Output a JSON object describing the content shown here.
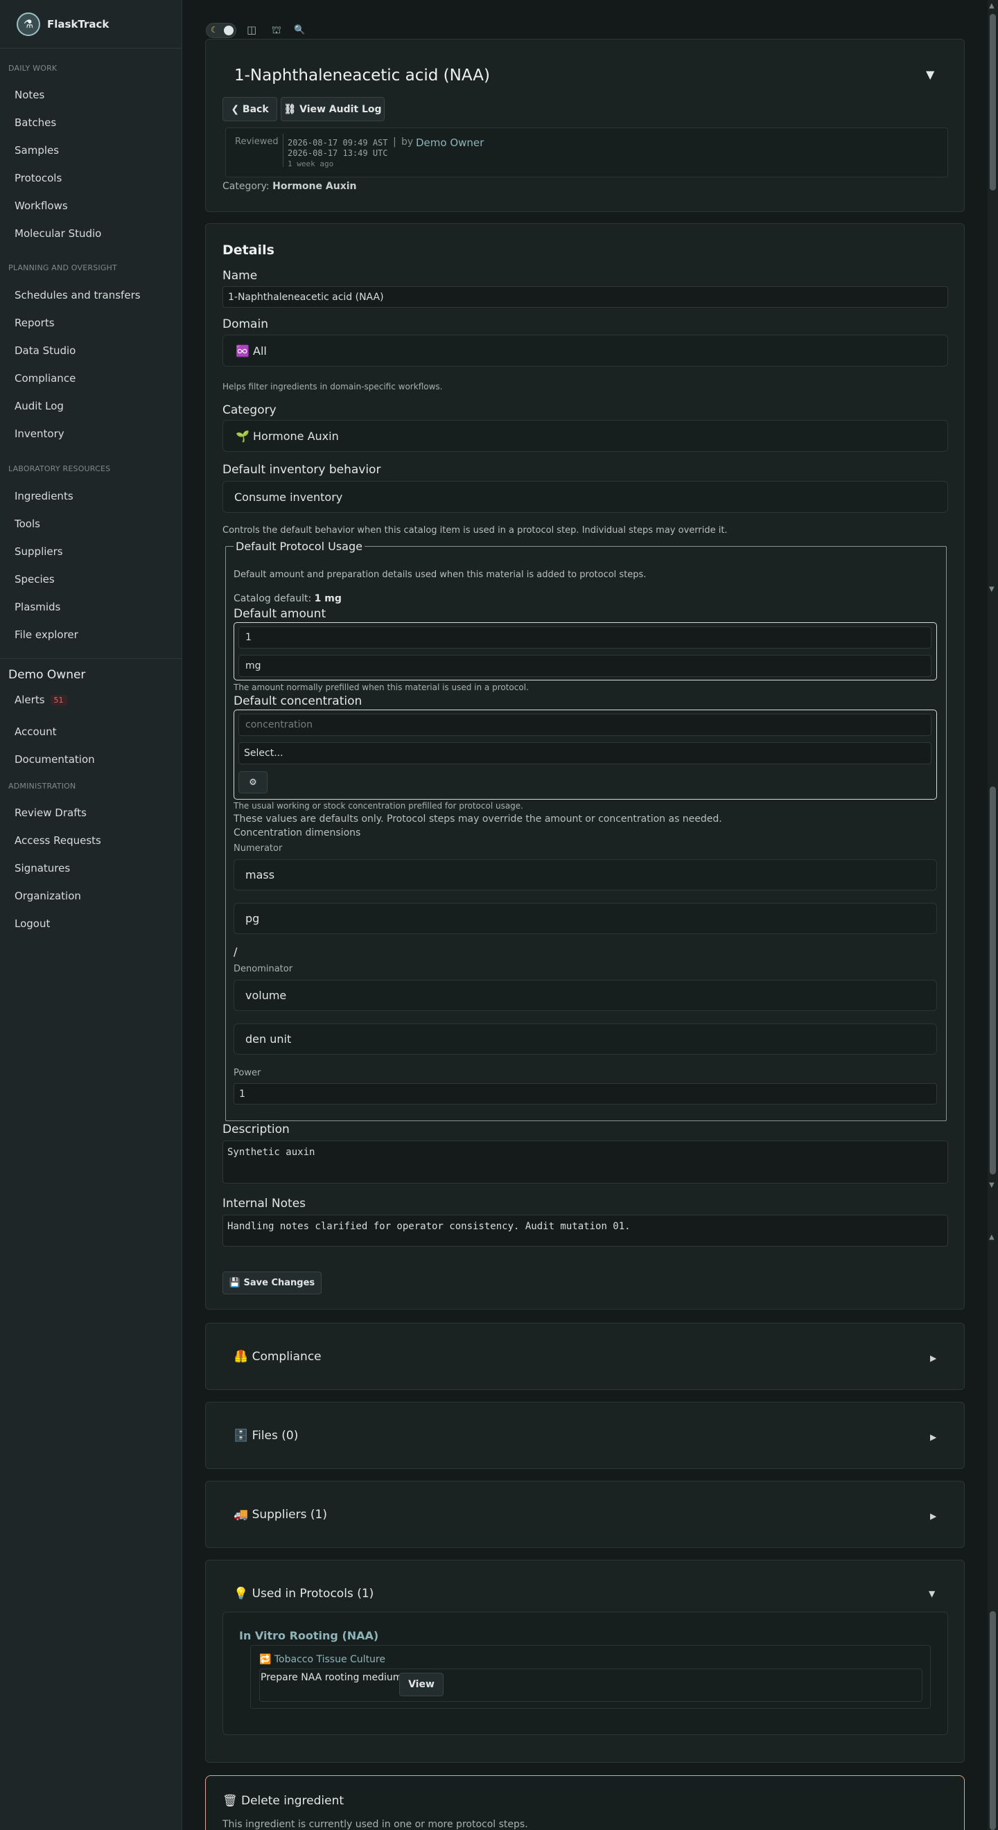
{
  "sidebar": {
    "brand": "FlaskTrack",
    "sections": [
      {
        "title": "DAILY WORK",
        "items": [
          "Notes",
          "Batches",
          "Samples",
          "Protocols",
          "Workflows",
          "Molecular Studio"
        ]
      },
      {
        "title": "PLANNING AND OVERSIGHT",
        "items": [
          "Schedules and transfers",
          "Reports",
          "Data Studio",
          "Compliance",
          "Audit Log",
          "Inventory"
        ]
      },
      {
        "title": "LABORATORY RESOURCES",
        "items": [
          "Ingredients",
          "Tools",
          "Suppliers",
          "Species",
          "Plasmids",
          "File explorer"
        ]
      }
    ],
    "user": {
      "name": "Demo Owner",
      "alerts_label": "Alerts",
      "alerts_count": "51",
      "account": "Account",
      "documentation": "Documentation"
    },
    "admin": {
      "title": "ADMINISTRATION",
      "items": [
        "Review Drafts",
        "Access Requests",
        "Signatures",
        "Organization",
        "Logout"
      ]
    }
  },
  "toolbar": {
    "theme_icon": "moon-icon",
    "layout_icon": "columns-icon",
    "tree_icon": "hierarchy-icon",
    "search_icon": "search-icon"
  },
  "header": {
    "title": "1-Naphthaleneacetic acid (NAA)",
    "collapse_glyph": "▼",
    "back": "❮ Back",
    "audit": "⛓ View Audit Log",
    "review": {
      "label": "Reviewed",
      "local": "2026-08-17 09:49 AST",
      "utc": "2026-08-17 13:49 UTC",
      "ago": "1 week ago",
      "by": "by",
      "user": "Demo Owner"
    },
    "category_label": "Category:",
    "category_value": "Hormone Auxin"
  },
  "details": {
    "heading": "Details",
    "name_label": "Name",
    "name_value": "1-Naphthaleneacetic acid (NAA)",
    "domain_label": "Domain",
    "domain_value": "♾️ All",
    "domain_help": "Helps filter ingredients in domain-specific workflows.",
    "category_label": "Category",
    "category_value": "🌱 Hormone Auxin",
    "inventory_label": "Default inventory behavior",
    "inventory_value": "Consume inventory",
    "inventory_help": "Controls the default behavior when this catalog item is used in a protocol step. Individual steps may override it.",
    "usage": {
      "legend": "Default Protocol Usage",
      "intro": "Default amount and preparation details used when this material is added to protocol steps.",
      "catalog_default_label": "Catalog default:",
      "catalog_default_value": "1 mg",
      "amount_label": "Default amount",
      "amount_value": "1",
      "amount_unit": "mg",
      "amount_help": "The amount normally prefilled when this material is used in a protocol.",
      "conc_label": "Default concentration",
      "conc_placeholder": "concentration",
      "conc_select": "Select...",
      "conc_gear": "⚙",
      "conc_help": "The usual working or stock concentration prefilled for protocol usage.",
      "override_note": "These values are defaults only. Protocol steps may override the amount or concentration as needed.",
      "dims_label": "Concentration dimensions",
      "numerator_label": "Numerator",
      "numerator_value": "mass",
      "numerator_unit": "pg",
      "slash": "/",
      "denominator_label": "Denominator",
      "denominator_value": "volume",
      "denominator_unit": "den unit",
      "power_label": "Power",
      "power_value": "1"
    },
    "description_label": "Description",
    "description_value": "Synthetic auxin",
    "notes_label": "Internal Notes",
    "notes_value": "Handling notes clarified for operator consistency. Audit mutation 01.",
    "save": "💾 Save Changes"
  },
  "panels": {
    "compliance": "🦺 Compliance",
    "files": "🗄️ Files (0)",
    "suppliers": "🚚 Suppliers (1)",
    "protocols": "💡 Used in Protocols (1)",
    "arrow_closed": "▶",
    "arrow_open": "▼"
  },
  "protocols": {
    "title": "In Vitro Rooting (NAA)",
    "workflow": "🔁 Tobacco Tissue Culture",
    "step": "Prepare NAA rooting medium",
    "view": "View"
  },
  "danger": {
    "title": "🗑 Delete ingredient",
    "text": "This ingredient is currently used in one or more protocol steps."
  },
  "colors": {
    "accent": "#8fb4b8",
    "danger_border": "#e5a39a",
    "background": "#141a1a"
  }
}
